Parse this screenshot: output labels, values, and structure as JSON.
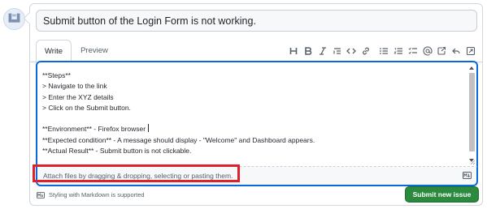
{
  "issue": {
    "title_value": "Submit button of the Login Form is not working."
  },
  "tabs": [
    {
      "label": "Write"
    },
    {
      "label": "Preview"
    }
  ],
  "toolbar": {
    "icons": [
      "heading-icon",
      "bold-icon",
      "italic-icon",
      "quote-icon",
      "code-icon",
      "link-icon",
      "unordered-list-icon",
      "ordered-list-icon",
      "task-list-icon",
      "mention-icon",
      "reference-icon",
      "reply-icon",
      "expand-icon"
    ]
  },
  "editor": {
    "lines": [
      "**Steps**",
      "> Navigate to the link",
      "> Enter the XYZ details",
      "> Click on the Submit button.",
      "",
      "**Environment** - Firefox browser",
      "**Expected condition** - A message should display - \"Welcome\" and Dashboard appears.",
      "**Actual Result** - Submit button is not clickable."
    ]
  },
  "attach": {
    "text": "Attach files by dragging & dropping, selecting or pasting them."
  },
  "footer": {
    "markdown_note": "Styling with Markdown is supported",
    "submit_label": "Submit new issue"
  },
  "colors": {
    "accent": "#0969da",
    "submit_bg": "#2b8a3e",
    "highlight": "#e0202b"
  }
}
